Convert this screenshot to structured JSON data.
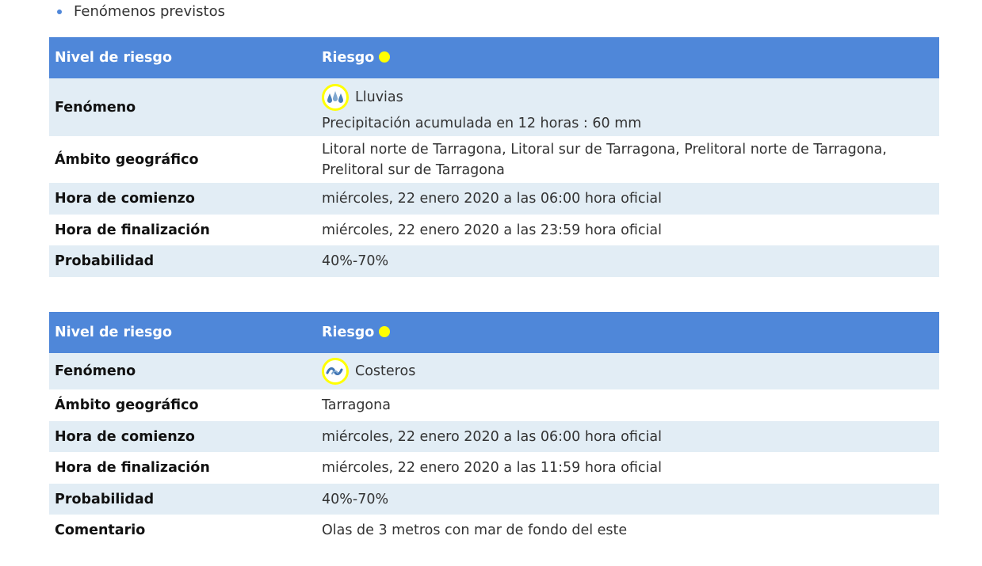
{
  "section": {
    "bullet": "Fenómenos previstos"
  },
  "alerts": [
    {
      "header": {
        "col1": "Nivel de riesgo",
        "col2": "Riesgo"
      },
      "risk_color": "#ffff00",
      "rows": {
        "phenomenon": {
          "label": "Fenómeno",
          "value": "Lluvias",
          "detail": "Precipitación acumulada en 12 horas : 60 mm",
          "icon": "rain-drops-icon"
        },
        "area": {
          "label": "Ámbito geográfico",
          "value": "Litoral norte de Tarragona, Litoral sur de Tarragona, Prelitoral norte de Tarragona, Prelitoral sur de Tarragona"
        },
        "start": {
          "label": "Hora de comienzo",
          "value": "miércoles, 22 enero 2020 a las 06:00 hora oficial"
        },
        "end": {
          "label": "Hora de finalización",
          "value": "miércoles, 22 enero 2020 a las 23:59 hora oficial"
        },
        "probability": {
          "label": "Probabilidad",
          "value": "40%-70%"
        }
      }
    },
    {
      "header": {
        "col1": "Nivel de riesgo",
        "col2": "Riesgo"
      },
      "risk_color": "#ffff00",
      "rows": {
        "phenomenon": {
          "label": "Fenómeno",
          "value": "Costeros",
          "icon": "coastal-waves-icon"
        },
        "area": {
          "label": "Ámbito geográfico",
          "value": "Tarragona"
        },
        "start": {
          "label": "Hora de comienzo",
          "value": "miércoles, 22 enero 2020 a las 06:00 hora oficial"
        },
        "end": {
          "label": "Hora de finalización",
          "value": "miércoles, 22 enero 2020 a las 11:59 hora oficial"
        },
        "probability": {
          "label": "Probabilidad",
          "value": "40%-70%"
        },
        "comment": {
          "label": "Comentario",
          "value": "Olas de 3 metros con mar de fondo del este"
        }
      }
    }
  ]
}
